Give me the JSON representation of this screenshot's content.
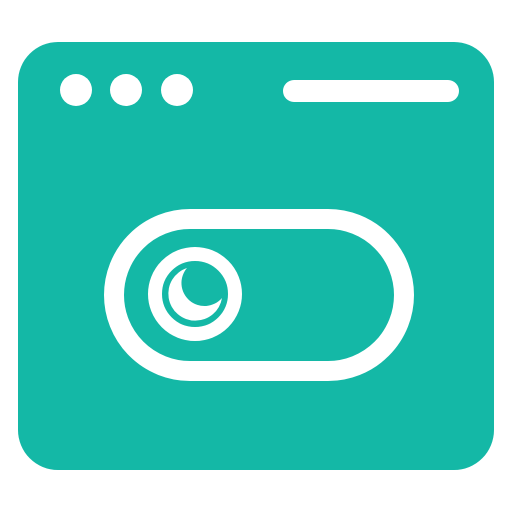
{
  "icon": {
    "name": "dark-mode-toggle-window-icon",
    "colors": {
      "window_fill": "#14b8a6",
      "foreground": "#ffffff",
      "background": "#ffffff"
    },
    "window_controls": [
      "dot",
      "dot",
      "dot"
    ],
    "toggle": {
      "state": "off",
      "knob_glyph": "crescent-moon-icon"
    }
  }
}
